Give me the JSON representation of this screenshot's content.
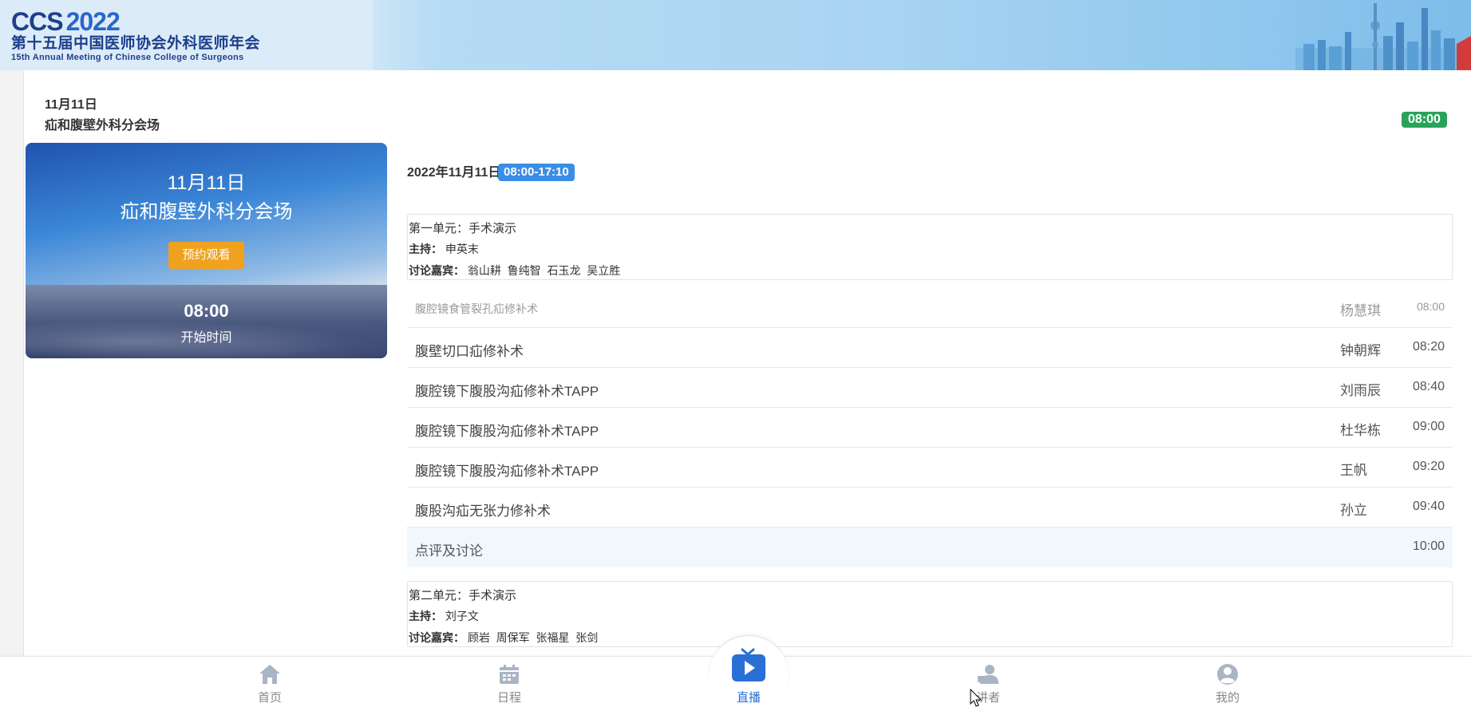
{
  "banner": {
    "logo_ccs": "CCS",
    "logo_year": "2022",
    "logo_cn": "第十五届中国医师协会外科医师年会",
    "logo_en": "15th Annual Meeting of Chinese College of Surgeons"
  },
  "header": {
    "date": "11月11日",
    "venue": "疝和腹壁外科分会场",
    "time_badge": "08:00"
  },
  "card": {
    "date": "11月11日",
    "venue": "疝和腹壁外科分会场",
    "reserve_label": "预约观看",
    "start_time": "08:00",
    "start_label": "开始时间"
  },
  "schedule": {
    "date": "2022年11月11日",
    "range": "08:00-17:10",
    "units": [
      {
        "title": "第一单元：手术演示",
        "host_label": "主持：",
        "host": "申英末",
        "discussants_label": "讨论嘉宾：",
        "discussants": "翁山耕  鲁纯智  石玉龙  吴立胜"
      },
      {
        "title": "第二单元：手术演示",
        "host_label": "主持：",
        "host": "刘子文",
        "discussants_label": "讨论嘉宾：",
        "discussants": "顾岩  周保军  张福星  张剑"
      }
    ],
    "talks": [
      {
        "title": "腹腔镜食管裂孔疝修补术",
        "speaker": "杨慧琪",
        "time": "08:00"
      },
      {
        "title": "腹壁切口疝修补术",
        "speaker": "钟朝辉",
        "time": "08:20"
      },
      {
        "title": "腹腔镜下腹股沟疝修补术TAPP",
        "speaker": "刘雨辰",
        "time": "08:40"
      },
      {
        "title": "腹腔镜下腹股沟疝修补术TAPP",
        "speaker": "杜华栋",
        "time": "09:00"
      },
      {
        "title": "腹腔镜下腹股沟疝修补术TAPP",
        "speaker": "王帆",
        "time": "09:20"
      },
      {
        "title": "腹股沟疝无张力修补术",
        "speaker": "孙立",
        "time": "09:40"
      },
      {
        "title": "点评及讨论",
        "speaker": "",
        "time": "10:00"
      }
    ]
  },
  "nav": {
    "home": "首页",
    "schedule": "日程",
    "live": "直播",
    "speakers": "讲者",
    "mine": "我的"
  },
  "colors": {
    "accent_blue": "#2a6fd6",
    "badge_green": "#2aa35a",
    "range_blue": "#3a8ee6",
    "reserve_orange": "#f0a11e"
  }
}
